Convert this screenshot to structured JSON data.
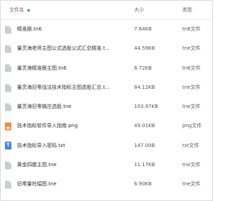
{
  "header": {
    "name_label": "文件名",
    "size_label": "大小",
    "type_label": "类型"
  },
  "files": [
    {
      "icon": "document-icon",
      "name": "精准跟.tn6",
      "size": "7.64KB",
      "type": "tn6文件"
    },
    {
      "icon": "document-icon",
      "name": "量灵海老师主图公式选股公式汇总精准.t...",
      "size": "44.59KB",
      "type": "tne文件"
    },
    {
      "icon": "document-icon",
      "name": "量灵海精准跟主图.tn6",
      "size": "6.72KB",
      "type": "tn6文件"
    },
    {
      "icon": "document-icon",
      "name": "量灵海旧零战法技术指标主图选股汇总.t...",
      "size": "84.12KB",
      "type": "tne文件"
    },
    {
      "icon": "document-icon",
      "name": "量灵海旧零擒庄选股.tne",
      "size": "103.97KB",
      "type": "tne文件"
    },
    {
      "icon": "image-file-icon",
      "name": "技术指标软件导入指南.png",
      "size": "49.01KB",
      "type": "png文件"
    },
    {
      "icon": "text-file-icon",
      "name": "技术指标导入密码.txt",
      "size": "147.00B",
      "type": "txt文件"
    },
    {
      "icon": "document-icon",
      "name": "黄金四膝主图.tne",
      "size": "11.17KB",
      "type": "tne文件"
    },
    {
      "icon": "document-icon",
      "name": "旧零量柱幅图.tne",
      "size": "6.90KB",
      "type": "tne文件"
    }
  ]
}
